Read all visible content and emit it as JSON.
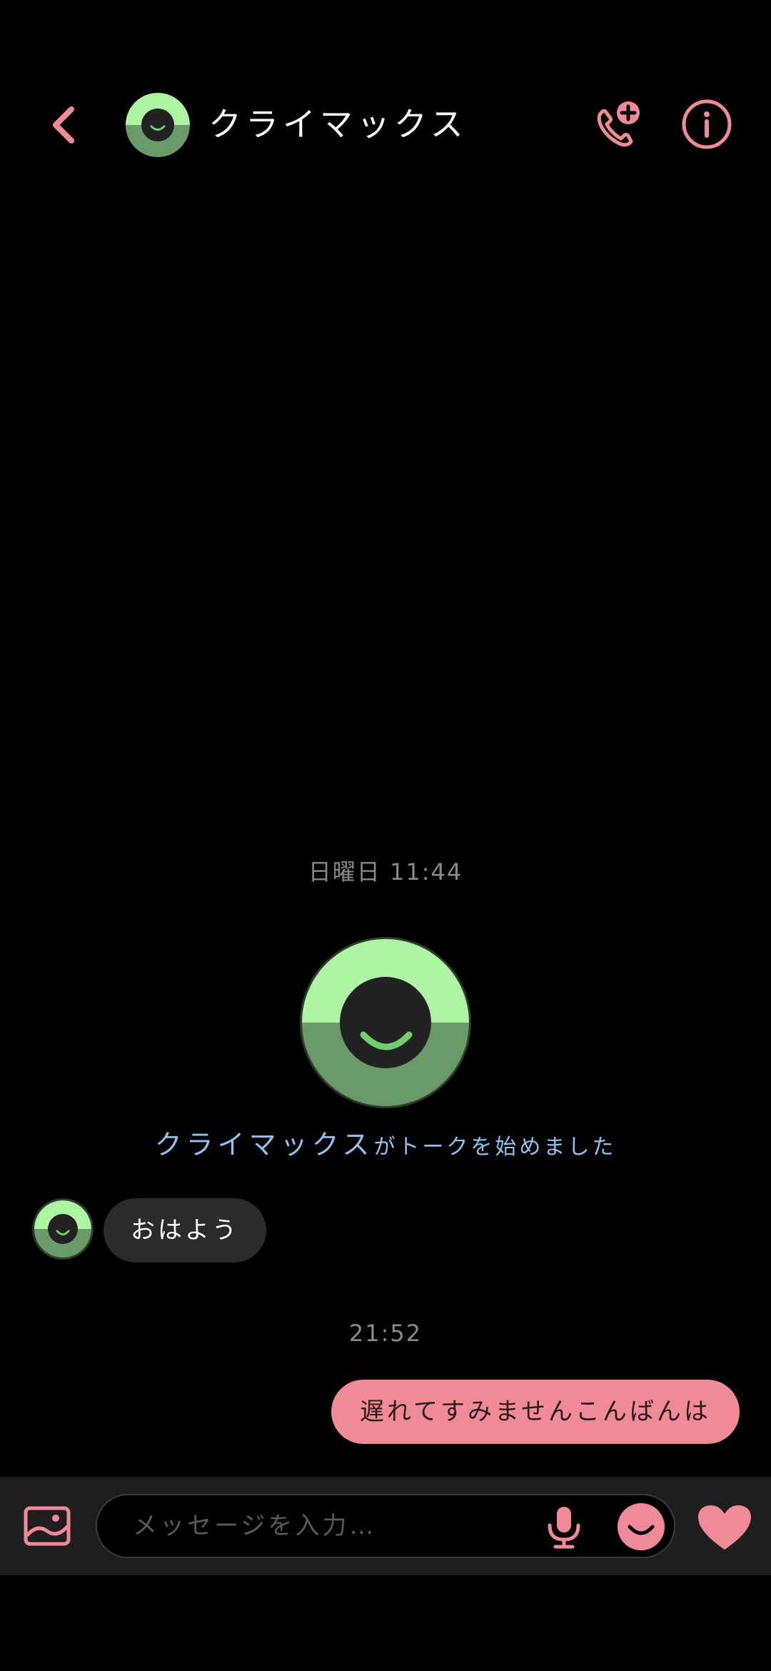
{
  "header": {
    "title": "クライマックス",
    "back_icon": "chevron-left-icon",
    "call_icon": "add-call-icon",
    "info_icon": "info-icon"
  },
  "chat": {
    "date_label": "日曜日 11:44",
    "started_name": "クライマックス",
    "started_text": "がトークを始めました",
    "incoming_message": "おはよう",
    "time_label": "21:52",
    "outgoing_message": "遅れてすみませんこんばんは"
  },
  "input_bar": {
    "placeholder": "メッセージを入力…",
    "photo_icon": "image-icon",
    "mic_icon": "microphone-icon",
    "emoji_icon": "emoji-icon",
    "like_icon": "heart-icon"
  },
  "colors": {
    "accent": "#f08a96",
    "avatar_top": "#aef5a3",
    "avatar_bottom": "#6a9a68",
    "system_text": "#8fc3ef",
    "bar_bg": "#1e1e1e"
  }
}
